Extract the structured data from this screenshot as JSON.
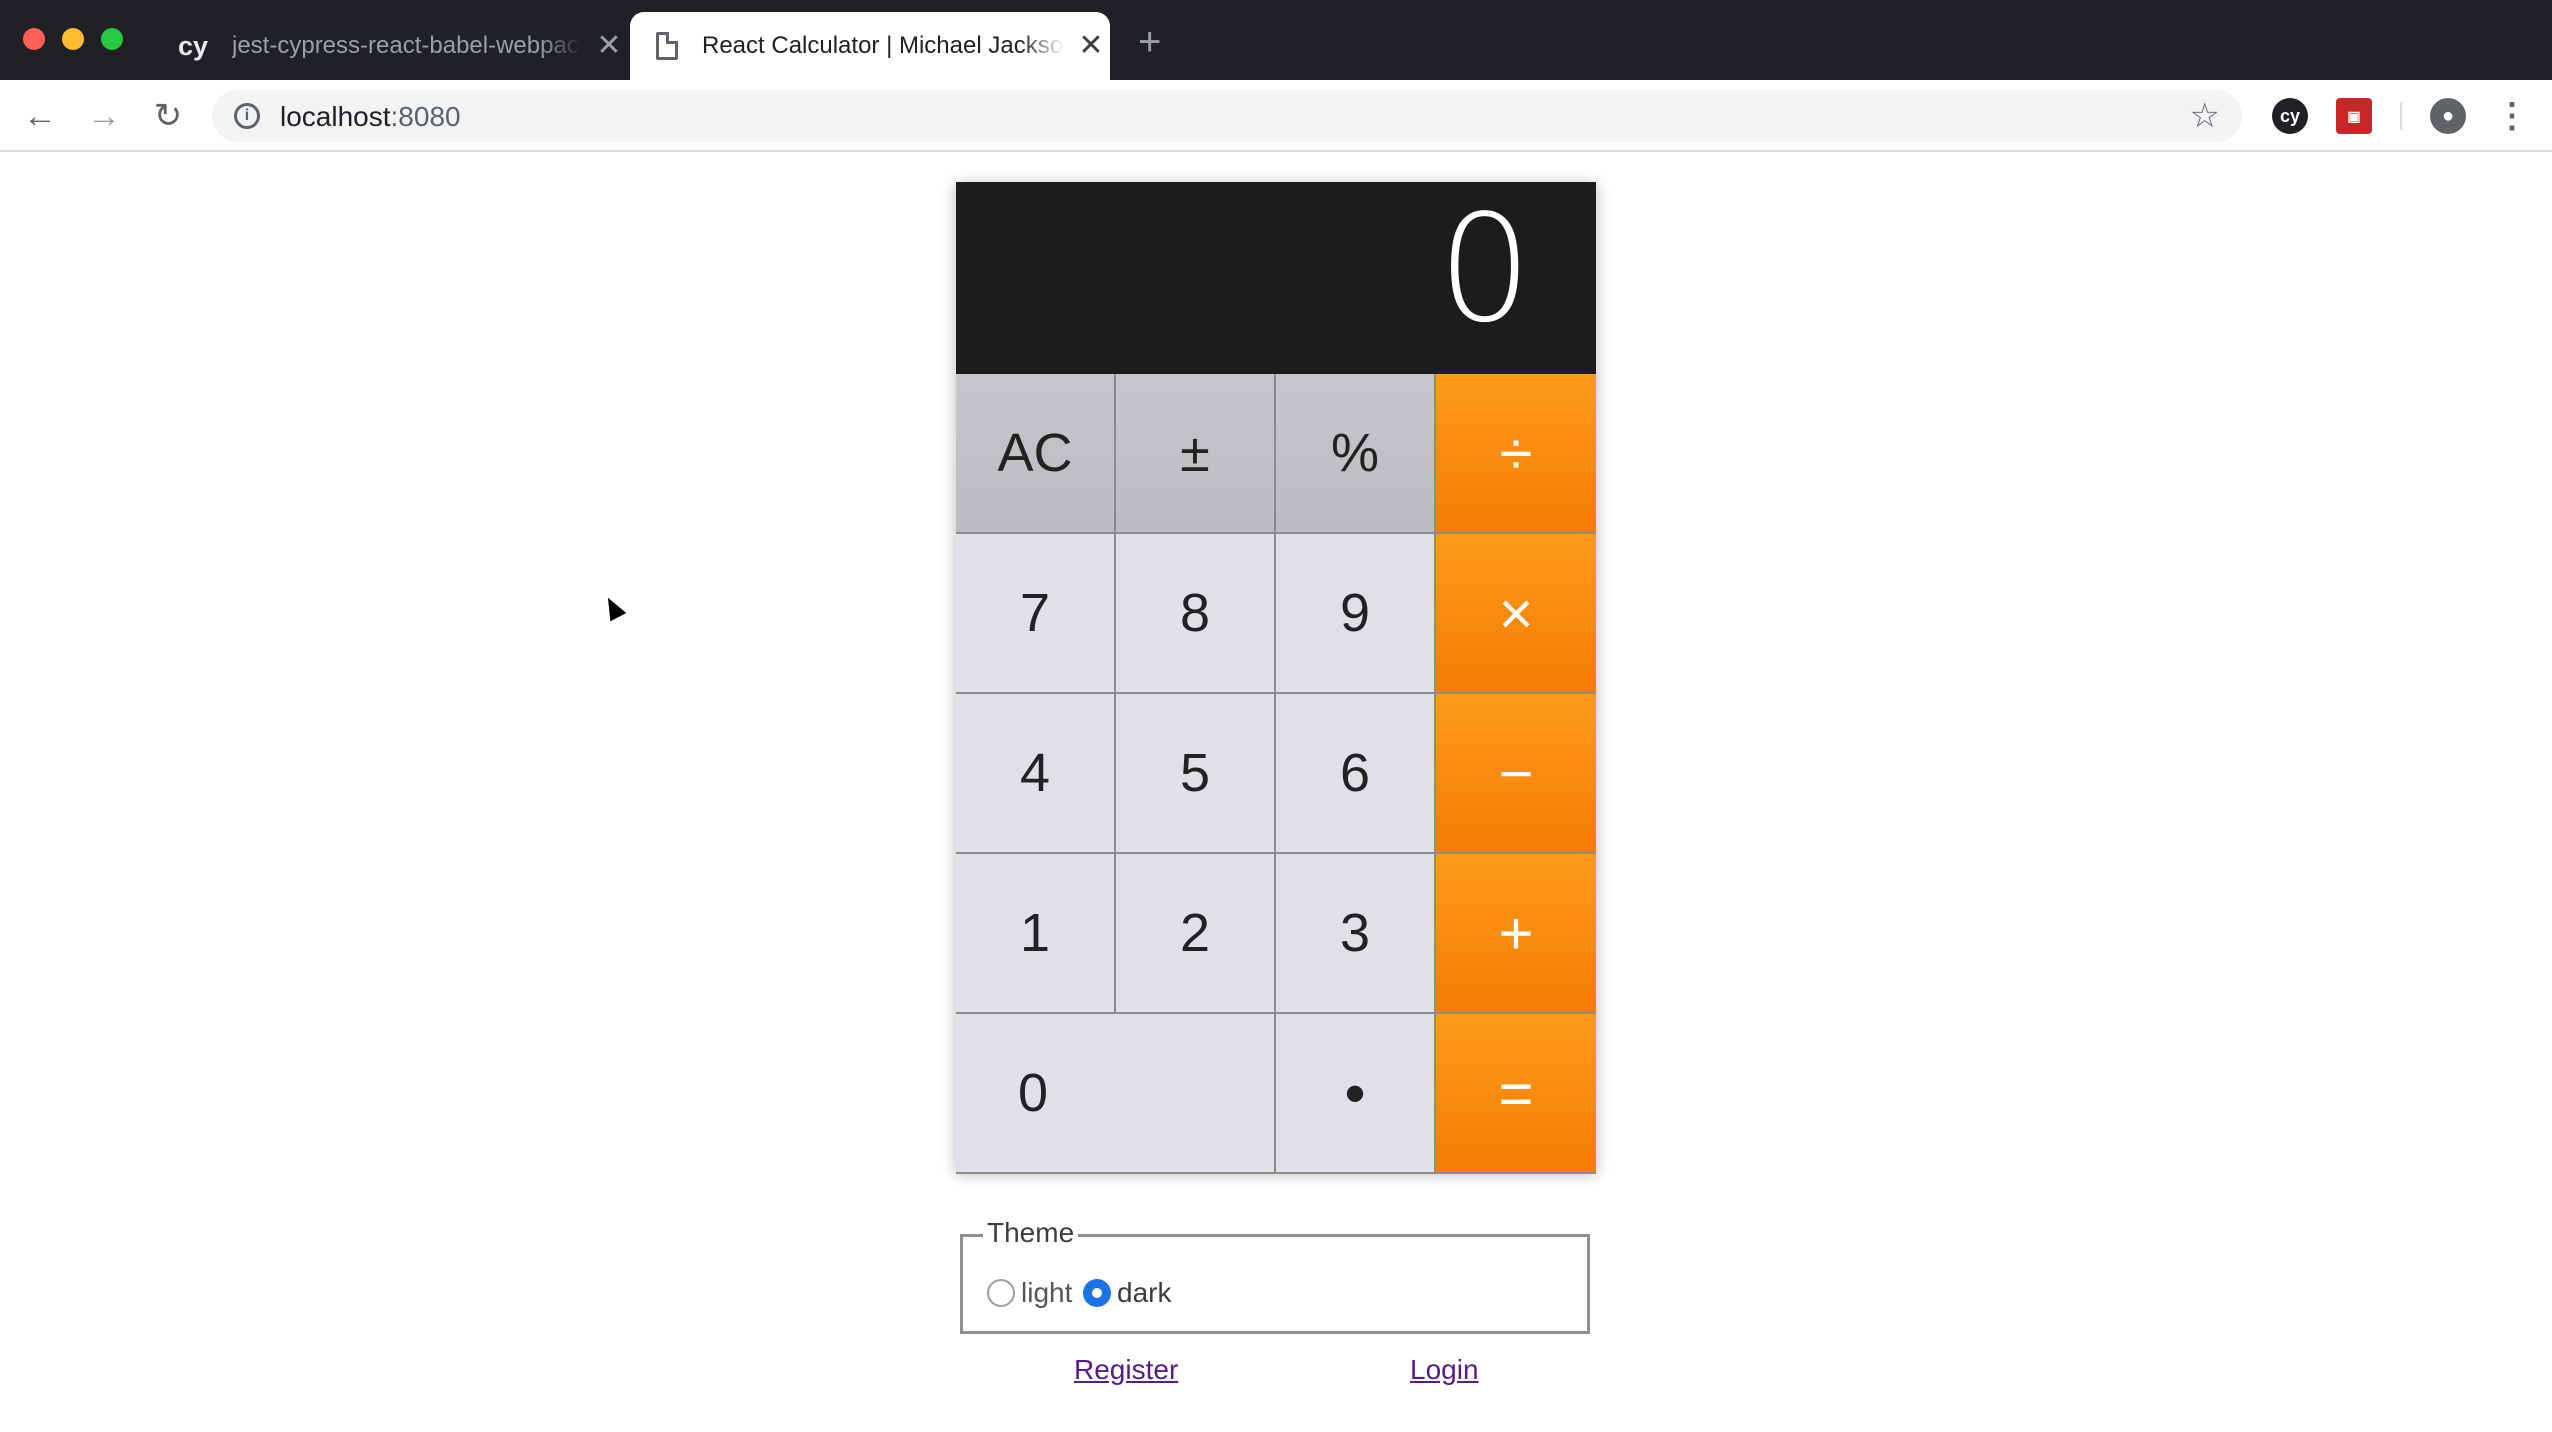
{
  "browser": {
    "tabs": [
      {
        "favicon": "cy",
        "title": "jest-cypress-react-babel-webpack",
        "active": false
      },
      {
        "favicon": "document-icon",
        "title": "React Calculator | Michael Jackson",
        "active": true
      }
    ],
    "close_glyph": "✕",
    "new_tab_glyph": "+",
    "address": {
      "host": "localhost",
      "port": ":8080"
    },
    "info_glyph": "i",
    "star_glyph": "☆",
    "extensions": {
      "cy": "cy",
      "red": "▣",
      "menu": "⋮",
      "profile": "●"
    },
    "nav": {
      "back": "←",
      "forward": "→",
      "reload": "↻"
    }
  },
  "calculator": {
    "display_value": "0",
    "keys": {
      "clear": "AC",
      "sign": "±",
      "percent": "%",
      "divide": "÷",
      "seven": "7",
      "eight": "8",
      "nine": "9",
      "multiply": "×",
      "four": "4",
      "five": "5",
      "six": "6",
      "subtract": "−",
      "one": "1",
      "two": "2",
      "three": "3",
      "add": "+",
      "zero": "0",
      "dot": "•",
      "equals": "="
    },
    "colors": {
      "display_bg": "#1c1c1c",
      "operator": "#f57d03",
      "function_key": "#c3c3c7",
      "digit_key": "#e0e0e7"
    }
  },
  "theme": {
    "legend": "Theme",
    "options": [
      {
        "label": "light",
        "checked": false
      },
      {
        "label": "dark",
        "checked": true
      }
    ]
  },
  "links": {
    "register": "Register",
    "login": "Login"
  }
}
